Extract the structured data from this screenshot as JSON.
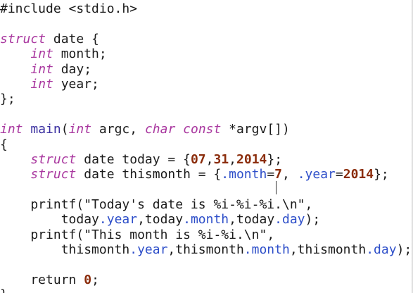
{
  "editor": {
    "lines": [
      [
        {
          "t": "#include <stdio.h>",
          "c": "plain"
        }
      ],
      [],
      [
        {
          "t": "struct",
          "c": "kw"
        },
        {
          "t": " date {",
          "c": "plain"
        }
      ],
      [
        {
          "t": "    ",
          "c": "plain"
        },
        {
          "t": "int",
          "c": "kw"
        },
        {
          "t": " month;",
          "c": "plain"
        }
      ],
      [
        {
          "t": "    ",
          "c": "plain"
        },
        {
          "t": "int",
          "c": "kw"
        },
        {
          "t": " day;",
          "c": "plain"
        }
      ],
      [
        {
          "t": "    ",
          "c": "plain"
        },
        {
          "t": "int",
          "c": "kw"
        },
        {
          "t": " year;",
          "c": "plain"
        }
      ],
      [
        {
          "t": "};",
          "c": "plain"
        }
      ],
      [],
      [
        {
          "t": "int",
          "c": "kw"
        },
        {
          "t": " ",
          "c": "plain"
        },
        {
          "t": "main",
          "c": "fn"
        },
        {
          "t": "(",
          "c": "plain"
        },
        {
          "t": "int",
          "c": "kw"
        },
        {
          "t": " argc, ",
          "c": "plain"
        },
        {
          "t": "char",
          "c": "kw"
        },
        {
          "t": " ",
          "c": "plain"
        },
        {
          "t": "const",
          "c": "kw"
        },
        {
          "t": " *argv[])",
          "c": "plain"
        }
      ],
      [
        {
          "t": "{",
          "c": "plain"
        }
      ],
      [
        {
          "t": "    ",
          "c": "plain"
        },
        {
          "t": "struct",
          "c": "kw"
        },
        {
          "t": " date today = {",
          "c": "plain"
        },
        {
          "t": "07",
          "c": "num"
        },
        {
          "t": ",",
          "c": "plain"
        },
        {
          "t": "31",
          "c": "num"
        },
        {
          "t": ",",
          "c": "plain"
        },
        {
          "t": "2014",
          "c": "num"
        },
        {
          "t": "};",
          "c": "plain"
        }
      ],
      [
        {
          "t": "    ",
          "c": "plain"
        },
        {
          "t": "struct",
          "c": "kw"
        },
        {
          "t": " date thismonth = {",
          "c": "plain"
        },
        {
          "t": ".month",
          "c": "member"
        },
        {
          "t": "=",
          "c": "plain"
        },
        {
          "t": "7",
          "c": "num"
        },
        {
          "t": ", ",
          "c": "plain"
        },
        {
          "t": ".year",
          "c": "member"
        },
        {
          "t": "=",
          "c": "plain"
        },
        {
          "t": "2014",
          "c": "num"
        },
        {
          "t": "};",
          "c": "plain"
        }
      ],
      [],
      [
        {
          "t": "    printf(",
          "c": "plain"
        },
        {
          "t": "\"Today's date is %i-%i-%i.\\n\"",
          "c": "str"
        },
        {
          "t": ",",
          "c": "plain"
        }
      ],
      [
        {
          "t": "        today",
          "c": "plain"
        },
        {
          "t": ".year",
          "c": "member"
        },
        {
          "t": ",today",
          "c": "plain"
        },
        {
          "t": ".month",
          "c": "member"
        },
        {
          "t": ",today",
          "c": "plain"
        },
        {
          "t": ".day",
          "c": "member"
        },
        {
          "t": ");",
          "c": "plain"
        }
      ],
      [
        {
          "t": "    printf(",
          "c": "plain"
        },
        {
          "t": "\"This month is %i-%i.\\n\"",
          "c": "str"
        },
        {
          "t": ",",
          "c": "plain"
        }
      ],
      [
        {
          "t": "        thismonth",
          "c": "plain"
        },
        {
          "t": ".year",
          "c": "member"
        },
        {
          "t": ",thismonth",
          "c": "plain"
        },
        {
          "t": ".month",
          "c": "member"
        },
        {
          "t": ",thismonth",
          "c": "plain"
        },
        {
          "t": ".day",
          "c": "member"
        },
        {
          "t": ");",
          "c": "plain"
        }
      ],
      [],
      [
        {
          "t": "    return ",
          "c": "plain"
        },
        {
          "t": "0",
          "c": "num"
        },
        {
          "t": ";",
          "c": "plain"
        }
      ],
      [
        {
          "t": "}",
          "c": "plain"
        }
      ]
    ]
  },
  "colors": {
    "keyword": "#a9379f",
    "function": "#3a2fa0",
    "number": "#8b2d0c",
    "member": "#2d4ec9",
    "text": "#1a1a1a",
    "background": "#ffffff"
  }
}
